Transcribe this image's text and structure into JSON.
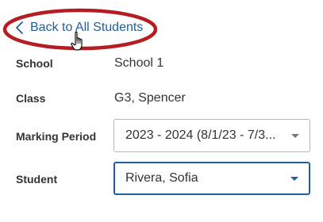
{
  "back_link": {
    "label": "Back to All Students"
  },
  "highlight_color": "#b61d23",
  "accent_color": "#1f5fa0",
  "fields": {
    "school": {
      "label": "School",
      "value": "School 1"
    },
    "class": {
      "label": "Class",
      "value": "G3, Spencer"
    },
    "marking_period": {
      "label": "Marking Period",
      "value": "2023 - 2024 (8/1/23 - 7/3..."
    },
    "student": {
      "label": "Student",
      "value": "Rivera, Sofia"
    }
  },
  "icons": {
    "back": "chevron-left-icon",
    "cursor": "hand-pointer-icon",
    "dropdown": "caret-down-icon"
  }
}
